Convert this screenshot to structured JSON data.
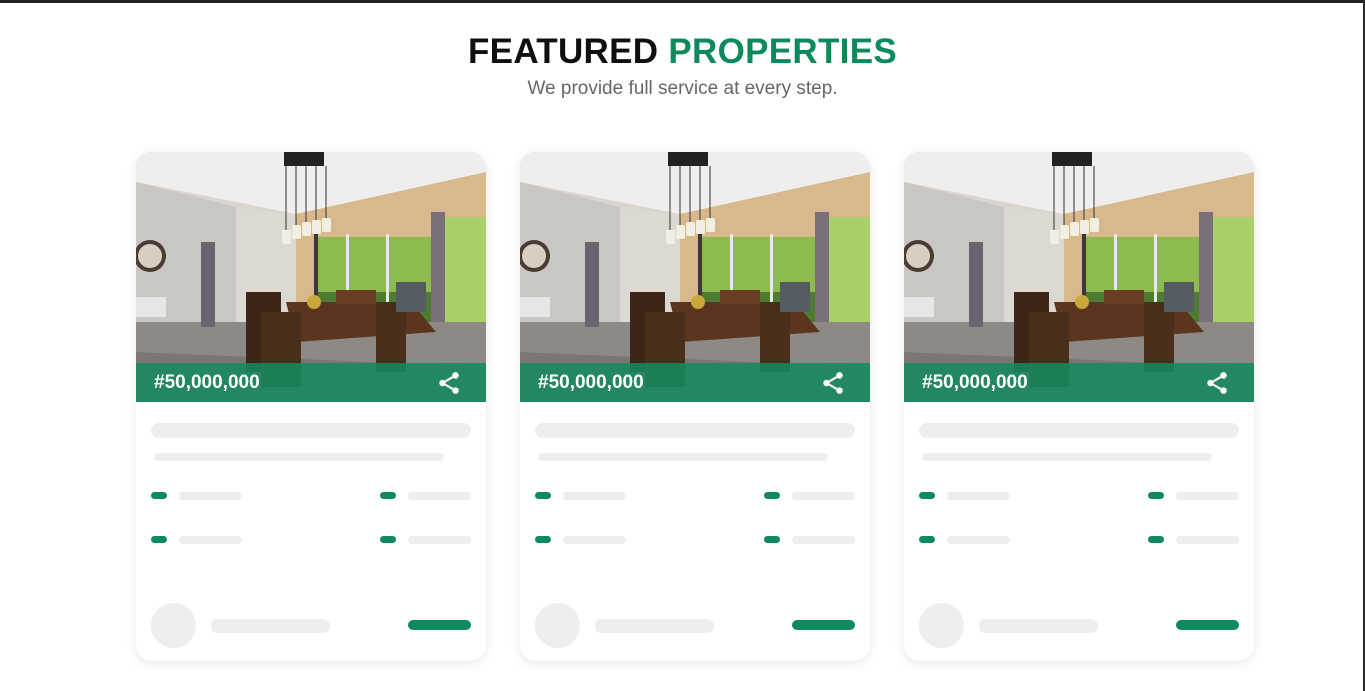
{
  "header": {
    "title_part1": "FEATURED",
    "title_part2": "PROPERTIES",
    "subtitle": "We provide full service at every step."
  },
  "colors": {
    "accent": "#0c8a5c",
    "skeleton": "#eeeeee"
  },
  "cards": [
    {
      "price": "#50,000,000",
      "share_icon": "share-icon"
    },
    {
      "price": "#50,000,000",
      "share_icon": "share-icon"
    },
    {
      "price": "#50,000,000",
      "share_icon": "share-icon"
    }
  ]
}
